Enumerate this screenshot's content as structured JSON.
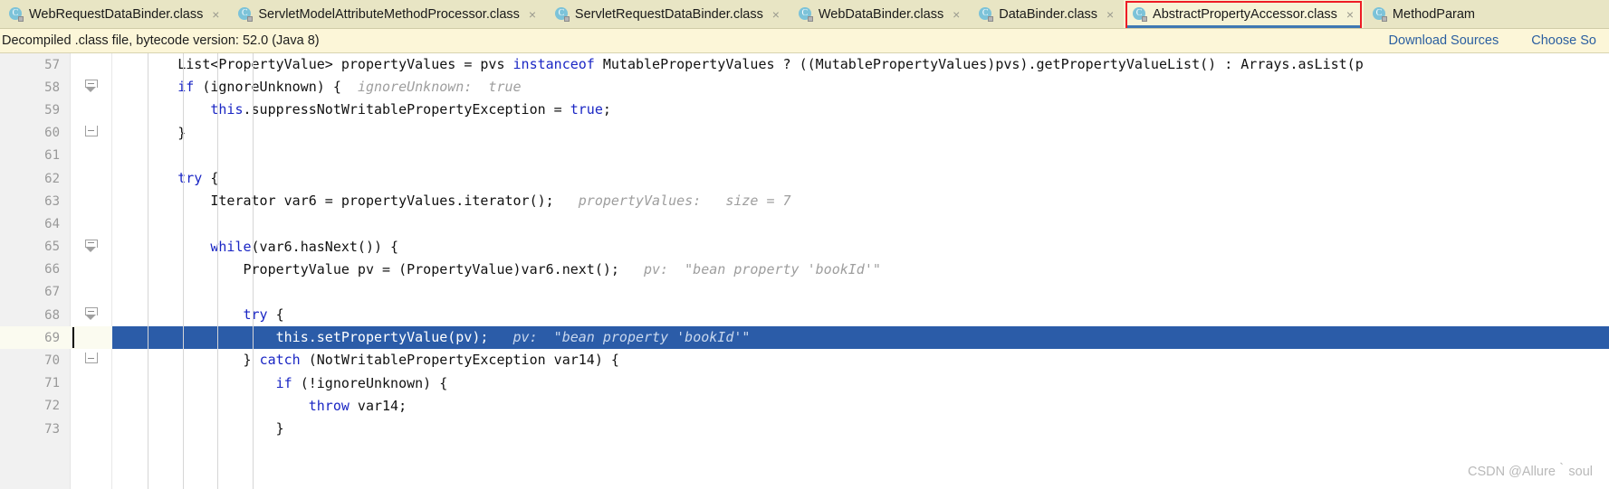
{
  "tabs": [
    {
      "label": "WebRequestDataBinder.class",
      "icon": "java-class-icon",
      "close": "×",
      "active": false,
      "boxed": false
    },
    {
      "label": "ServletModelAttributeMethodProcessor.class",
      "icon": "java-class-icon",
      "close": "×",
      "active": false,
      "boxed": false
    },
    {
      "label": "ServletRequestDataBinder.class",
      "icon": "java-class-icon",
      "close": "×",
      "active": false,
      "boxed": false
    },
    {
      "label": "WebDataBinder.class",
      "icon": "java-class-icon",
      "close": "×",
      "active": false,
      "boxed": false
    },
    {
      "label": "DataBinder.class",
      "icon": "java-class-icon",
      "close": "×",
      "active": false,
      "boxed": false
    },
    {
      "label": "AbstractPropertyAccessor.class",
      "icon": "java-class-icon",
      "close": "×",
      "active": true,
      "boxed": true
    },
    {
      "label": "MethodParam",
      "icon": "java-class-icon",
      "close": "",
      "active": false,
      "boxed": false
    }
  ],
  "notification": {
    "message": "Decompiled .class file, bytecode version: 52.0 (Java 8)",
    "download_sources_label": "Download Sources",
    "choose_sources_label": "Choose So"
  },
  "editor": {
    "class_icon_letter": "C",
    "lines": [
      {
        "no": "57",
        "fold": "",
        "current": false,
        "selected": false,
        "segments": [
          {
            "t": "        List<PropertyValue> propertyValues = pvs ",
            "c": "plain"
          },
          {
            "t": "instanceof",
            "c": "kw"
          },
          {
            "t": " MutablePropertyValues ? ((MutablePropertyValues)pvs).getPropertyValueList() : Arrays.asList(p",
            "c": "plain"
          }
        ]
      },
      {
        "no": "58",
        "fold": "collapse",
        "current": false,
        "selected": false,
        "segments": [
          {
            "t": "        ",
            "c": "plain"
          },
          {
            "t": "if",
            "c": "kw"
          },
          {
            "t": " (ignoreUnknown) {  ",
            "c": "plain"
          },
          {
            "t": "ignoreUnknown:  true",
            "c": "hint"
          }
        ]
      },
      {
        "no": "59",
        "fold": "",
        "current": false,
        "selected": false,
        "segments": [
          {
            "t": "            ",
            "c": "plain"
          },
          {
            "t": "this",
            "c": "kw"
          },
          {
            "t": ".suppressNotWritablePropertyException = ",
            "c": "plain"
          },
          {
            "t": "true",
            "c": "kw"
          },
          {
            "t": ";",
            "c": "plain"
          }
        ]
      },
      {
        "no": "60",
        "fold": "end",
        "current": false,
        "selected": false,
        "segments": [
          {
            "t": "        }",
            "c": "plain"
          }
        ]
      },
      {
        "no": "61",
        "fold": "",
        "current": false,
        "selected": false,
        "segments": [
          {
            "t": "",
            "c": "plain"
          }
        ]
      },
      {
        "no": "62",
        "fold": "",
        "current": false,
        "selected": false,
        "segments": [
          {
            "t": "        ",
            "c": "plain"
          },
          {
            "t": "try",
            "c": "kw"
          },
          {
            "t": " {",
            "c": "plain"
          }
        ]
      },
      {
        "no": "63",
        "fold": "",
        "current": false,
        "selected": false,
        "segments": [
          {
            "t": "            Iterator var6 = propertyValues.iterator();   ",
            "c": "plain"
          },
          {
            "t": "propertyValues:   size = 7",
            "c": "hint"
          }
        ]
      },
      {
        "no": "64",
        "fold": "",
        "current": false,
        "selected": false,
        "segments": [
          {
            "t": "",
            "c": "plain"
          }
        ]
      },
      {
        "no": "65",
        "fold": "collapse",
        "current": false,
        "selected": false,
        "segments": [
          {
            "t": "            ",
            "c": "plain"
          },
          {
            "t": "while",
            "c": "kw"
          },
          {
            "t": "(var6.hasNext()) {",
            "c": "plain"
          }
        ]
      },
      {
        "no": "66",
        "fold": "",
        "current": false,
        "selected": false,
        "segments": [
          {
            "t": "                PropertyValue pv = (PropertyValue)var6.next();   ",
            "c": "plain"
          },
          {
            "t": "pv:  \"bean property 'bookId'\"",
            "c": "hint"
          }
        ]
      },
      {
        "no": "67",
        "fold": "",
        "current": false,
        "selected": false,
        "segments": [
          {
            "t": "",
            "c": "plain"
          }
        ]
      },
      {
        "no": "68",
        "fold": "collapse",
        "current": false,
        "selected": false,
        "segments": [
          {
            "t": "                ",
            "c": "plain"
          },
          {
            "t": "try",
            "c": "kw"
          },
          {
            "t": " {",
            "c": "plain"
          }
        ]
      },
      {
        "no": "69",
        "fold": "",
        "current": true,
        "selected": true,
        "segments": [
          {
            "t": "                    ",
            "c": "plain"
          },
          {
            "t": "this",
            "c": "kw"
          },
          {
            "t": ".setPropertyValue(pv);   ",
            "c": "plain"
          },
          {
            "t": "pv:  \"bean property 'bookId'\"",
            "c": "hint"
          }
        ]
      },
      {
        "no": "70",
        "fold": "end",
        "current": false,
        "selected": false,
        "segments": [
          {
            "t": "                } ",
            "c": "plain"
          },
          {
            "t": "catch",
            "c": "kw"
          },
          {
            "t": " (NotWritablePropertyException var14) {",
            "c": "plain"
          }
        ]
      },
      {
        "no": "71",
        "fold": "",
        "current": false,
        "selected": false,
        "segments": [
          {
            "t": "                    ",
            "c": "plain"
          },
          {
            "t": "if",
            "c": "kw"
          },
          {
            "t": " (!ignoreUnknown) {",
            "c": "plain"
          }
        ]
      },
      {
        "no": "72",
        "fold": "",
        "current": false,
        "selected": false,
        "segments": [
          {
            "t": "                        ",
            "c": "plain"
          },
          {
            "t": "throw",
            "c": "kw"
          },
          {
            "t": " var14;",
            "c": "plain"
          }
        ]
      },
      {
        "no": "73",
        "fold": "",
        "current": false,
        "selected": false,
        "segments": [
          {
            "t": "                    }",
            "c": "plain"
          }
        ]
      }
    ]
  },
  "watermark": "CSDN @Allure｀soul",
  "colors": {
    "tabbar_bg": "#e8e5c4",
    "notification_bg": "#fcf6d8",
    "accent_blue": "#2b5ca8",
    "highlight_red": "#ee1c25",
    "keyword_blue": "#1a26c4",
    "hint_gray": "#9e9e9e",
    "link_blue": "#2b5fa0"
  }
}
